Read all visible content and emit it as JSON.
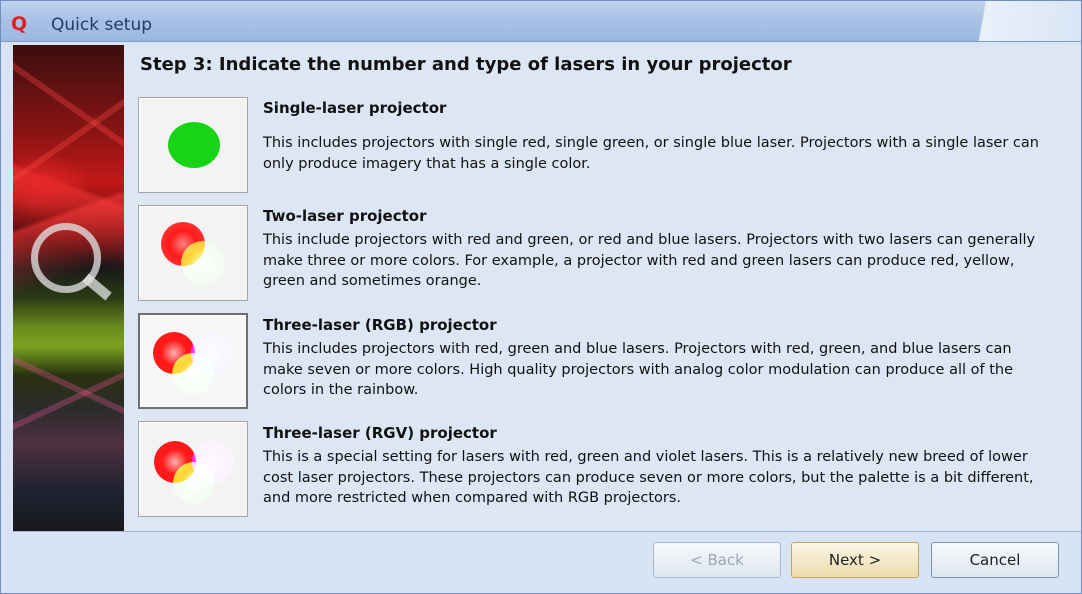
{
  "window": {
    "title": "Quick setup",
    "app_icon": "Q"
  },
  "step": {
    "title": "Step 3: Indicate the number and type of lasers in your projector"
  },
  "options": [
    {
      "title": "Single-laser projector",
      "description": "This includes projectors with single red, single green, or single blue laser. Projectors with a single laser can only produce imagery that has a single color.",
      "icon": "single-green-laser-icon",
      "selected": false
    },
    {
      "title": "Two-laser projector",
      "description": "This include projectors with red and green, or red and blue lasers. Projectors with two lasers can generally make three or more colors. For example, a projector with red and green lasers can produce red, yellow, green and sometimes orange.",
      "icon": "red-green-lasers-icon",
      "selected": false
    },
    {
      "title": "Three-laser (RGB) projector",
      "description": "This includes projectors with red, green and blue lasers. Projectors with red, green, and blue lasers can make seven or more colors. High quality projectors with analog color modulation can produce all of the colors in the rainbow.",
      "icon": "red-green-blue-lasers-icon",
      "selected": true
    },
    {
      "title": "Three-laser (RGV) projector",
      "description": "This is a special setting for lasers with red, green and violet lasers. This is a relatively new breed of lower cost laser projectors. These projectors can produce seven or more colors, but the palette is a bit different, and more restricted when compared with RGB projectors.",
      "icon": "red-green-violet-lasers-icon",
      "selected": false
    }
  ],
  "buttons": {
    "back": "< Back",
    "next": "Next >",
    "cancel": "Cancel"
  },
  "colors": {
    "red": "#ff1a1a",
    "green": "#1fd41f",
    "blue": "#1a1aff",
    "violet": "#b31aff"
  }
}
